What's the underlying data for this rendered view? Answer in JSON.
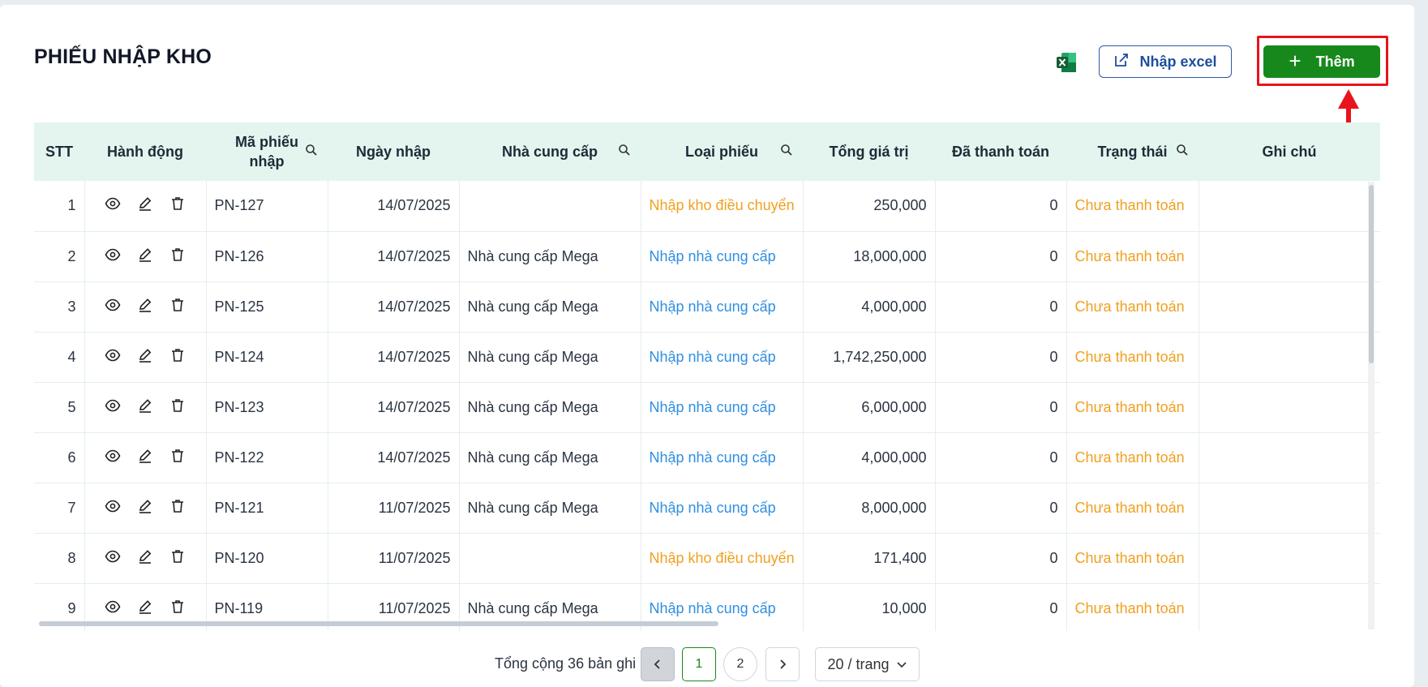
{
  "page": {
    "title": "PHIẾU NHẬP KHO",
    "import_excel_label": "Nhập excel",
    "add_label": "Thêm"
  },
  "table": {
    "headers": {
      "stt": "STT",
      "actions": "Hành động",
      "code": "Mã phiếu nhập",
      "date": "Ngày nhập",
      "supplier": "Nhà cung cấp",
      "type": "Loại phiếu",
      "total": "Tổng giá trị",
      "paid": "Đã thanh toán",
      "status": "Trạng thái",
      "note": "Ghi chú"
    },
    "rows": [
      {
        "stt": "1",
        "code": "PN-127",
        "date": "14/07/2025",
        "supplier": "",
        "type": "Nhập kho điều chuyển",
        "type_kind": "transfer",
        "total": "250,000",
        "paid": "0",
        "status": "Chưa thanh toán",
        "note": ""
      },
      {
        "stt": "2",
        "code": "PN-126",
        "date": "14/07/2025",
        "supplier": "Nhà cung cấp Mega",
        "type": "Nhập nhà cung cấp",
        "type_kind": "supplier",
        "total": "18,000,000",
        "paid": "0",
        "status": "Chưa thanh toán",
        "note": ""
      },
      {
        "stt": "3",
        "code": "PN-125",
        "date": "14/07/2025",
        "supplier": "Nhà cung cấp Mega",
        "type": "Nhập nhà cung cấp",
        "type_kind": "supplier",
        "total": "4,000,000",
        "paid": "0",
        "status": "Chưa thanh toán",
        "note": ""
      },
      {
        "stt": "4",
        "code": "PN-124",
        "date": "14/07/2025",
        "supplier": "Nhà cung cấp Mega",
        "type": "Nhập nhà cung cấp",
        "type_kind": "supplier",
        "total": "1,742,250,000",
        "paid": "0",
        "status": "Chưa thanh toán",
        "note": ""
      },
      {
        "stt": "5",
        "code": "PN-123",
        "date": "14/07/2025",
        "supplier": "Nhà cung cấp Mega",
        "type": "Nhập nhà cung cấp",
        "type_kind": "supplier",
        "total": "6,000,000",
        "paid": "0",
        "status": "Chưa thanh toán",
        "note": ""
      },
      {
        "stt": "6",
        "code": "PN-122",
        "date": "14/07/2025",
        "supplier": "Nhà cung cấp Mega",
        "type": "Nhập nhà cung cấp",
        "type_kind": "supplier",
        "total": "4,000,000",
        "paid": "0",
        "status": "Chưa thanh toán",
        "note": ""
      },
      {
        "stt": "7",
        "code": "PN-121",
        "date": "11/07/2025",
        "supplier": "Nhà cung cấp Mega",
        "type": "Nhập nhà cung cấp",
        "type_kind": "supplier",
        "total": "8,000,000",
        "paid": "0",
        "status": "Chưa thanh toán",
        "note": ""
      },
      {
        "stt": "8",
        "code": "PN-120",
        "date": "11/07/2025",
        "supplier": "",
        "type": "Nhập kho điều chuyển",
        "type_kind": "transfer",
        "total": "171,400",
        "paid": "0",
        "status": "Chưa thanh toán",
        "note": ""
      },
      {
        "stt": "9",
        "code": "PN-119",
        "date": "11/07/2025",
        "supplier": "Nhà cung cấp Mega",
        "type": "Nhập nhà cung cấp",
        "type_kind": "supplier",
        "total": "10,000",
        "paid": "0",
        "status": "Chưa thanh toán",
        "note": ""
      }
    ]
  },
  "pagination": {
    "total_text": "Tổng cộng 36 bản ghi",
    "pages": [
      "1",
      "2"
    ],
    "current_page": "1",
    "page_size": "20 / trang"
  },
  "colors": {
    "primary_green": "#17891c",
    "header_bg": "#e3f5ee",
    "transfer_orange": "#f0a020",
    "supplier_blue": "#2f8fe0",
    "annotation_red": "#e8141c"
  },
  "icons": {
    "excel": "excel-icon",
    "import": "import-edit-icon",
    "add": "plus-icon",
    "search": "search-icon",
    "view": "eye-icon",
    "edit": "pencil-icon",
    "delete": "trash-icon"
  }
}
